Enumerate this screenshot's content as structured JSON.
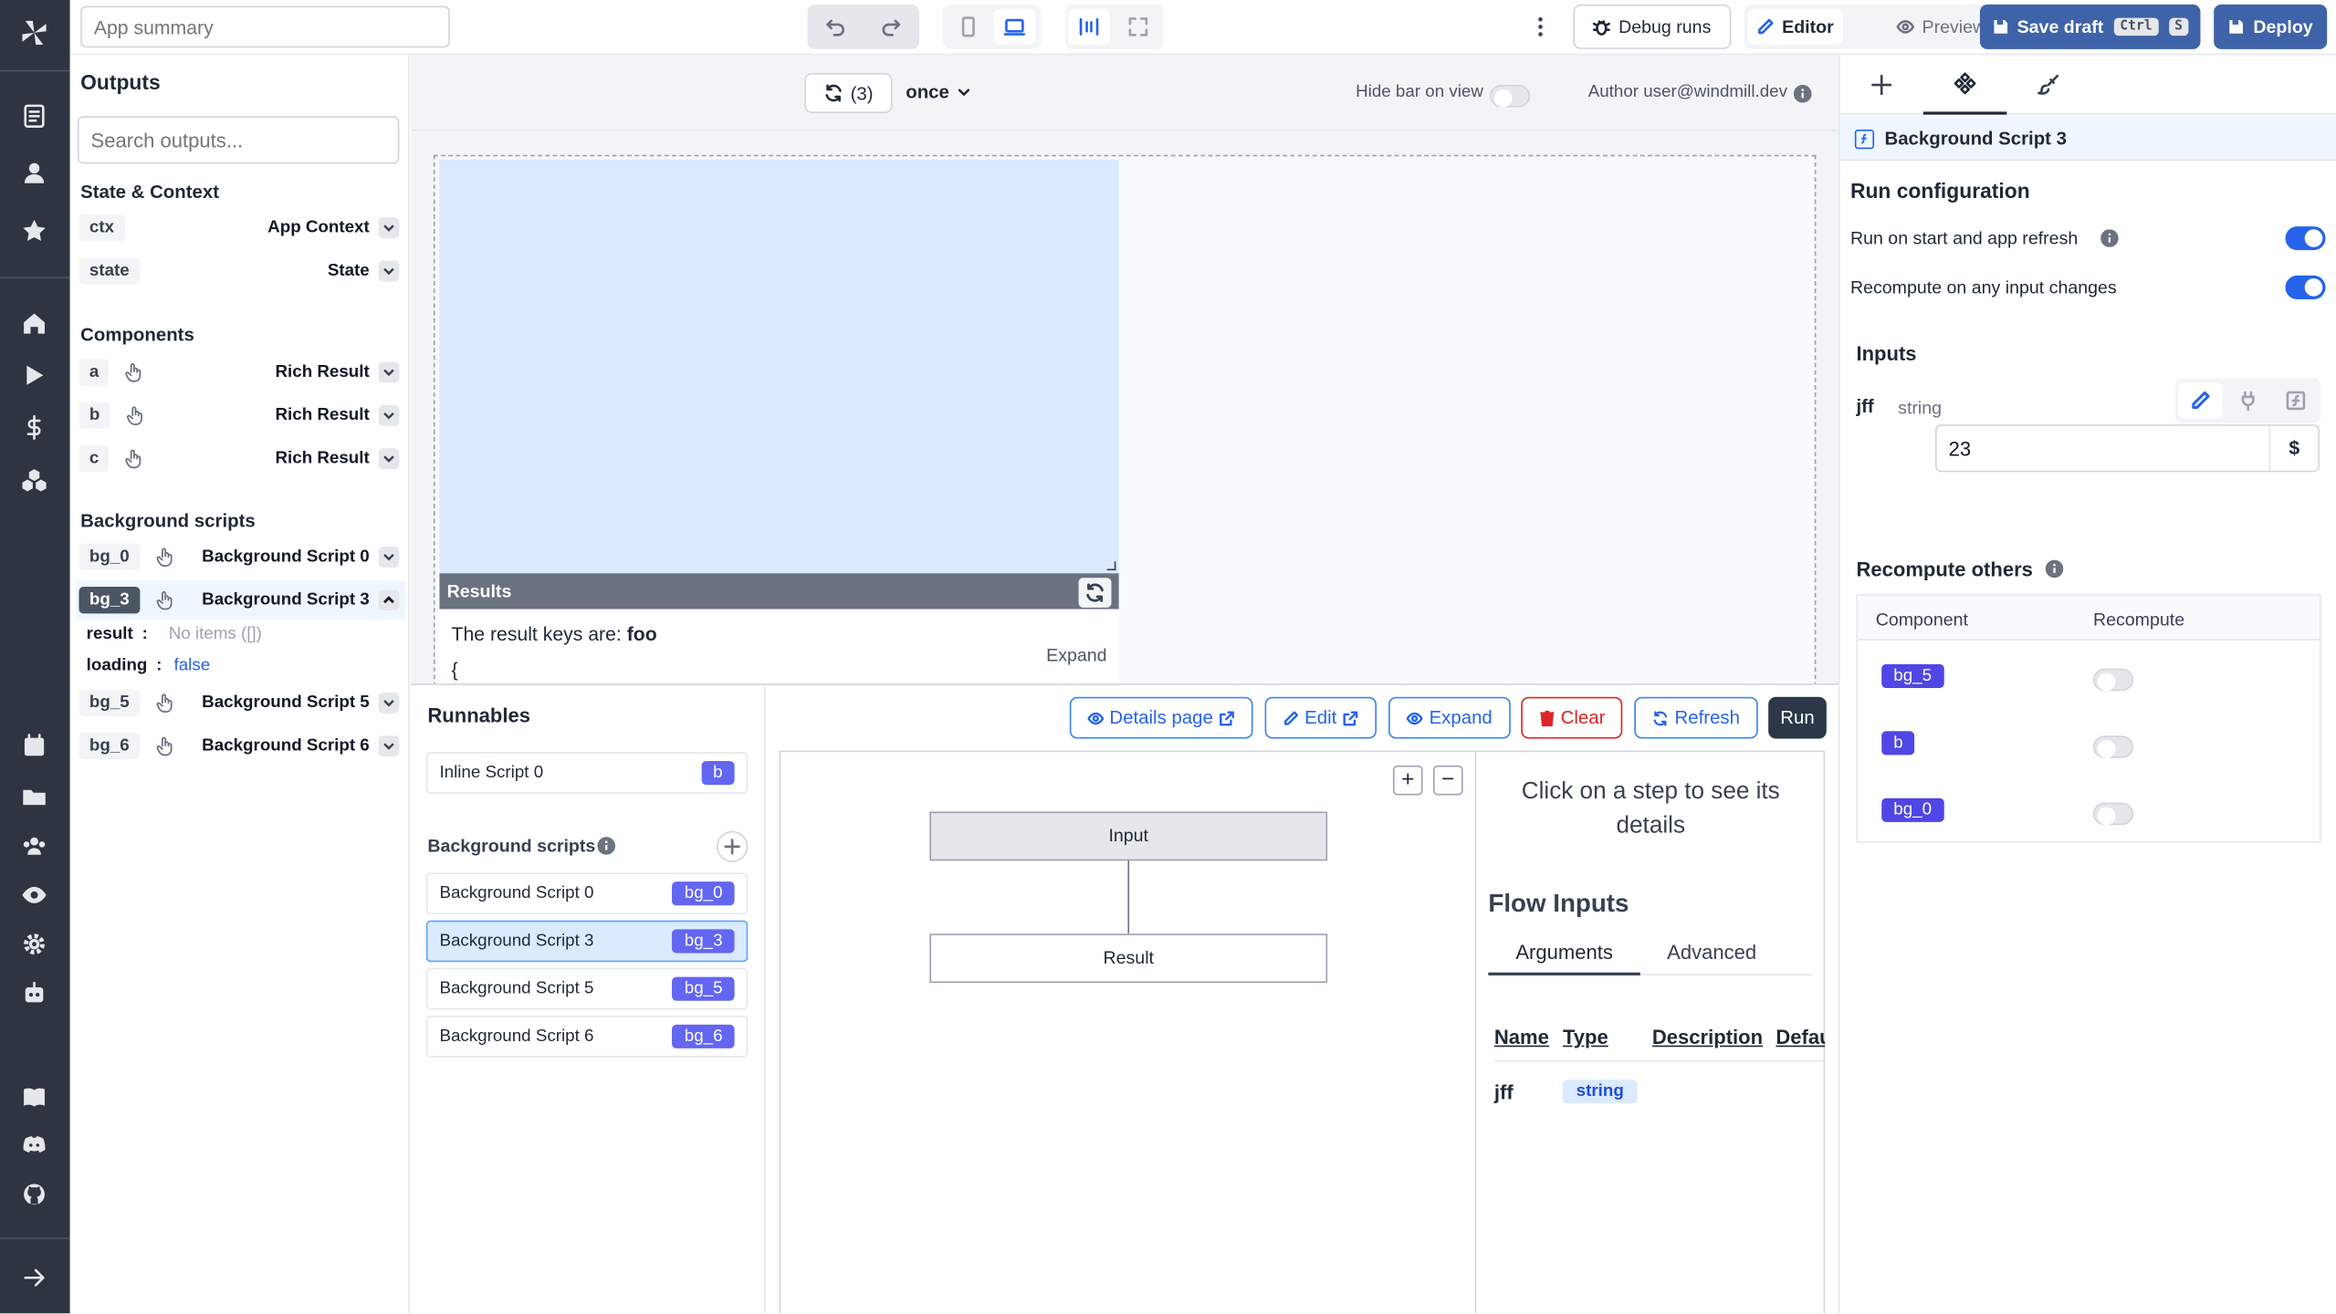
{
  "topbar": {
    "app_name_placeholder": "App summary",
    "debug_runs": "Debug runs",
    "editor": "Editor",
    "preview": "Preview",
    "save_draft": "Save draft",
    "kbd_ctrl": "Ctrl",
    "kbd_s": "S",
    "deploy": "Deploy"
  },
  "outputs": {
    "title": "Outputs",
    "search_placeholder": "Search outputs...",
    "state_context_title": "State & Context",
    "state_context": [
      {
        "id": "ctx",
        "name": "App Context"
      },
      {
        "id": "state",
        "name": "State"
      }
    ],
    "components_title": "Components",
    "components": [
      {
        "id": "a",
        "name": "Rich Result"
      },
      {
        "id": "b",
        "name": "Rich Result"
      },
      {
        "id": "c",
        "name": "Rich Result"
      }
    ],
    "background_title": "Background scripts",
    "background": [
      {
        "id": "bg_0",
        "name": "Background Script 0"
      },
      {
        "id": "bg_3",
        "name": "Background Script 3"
      },
      {
        "id": "bg_5",
        "name": "Background Script 5"
      },
      {
        "id": "bg_6",
        "name": "Background Script 6"
      }
    ],
    "expanded": {
      "result_key": "result",
      "result_sep": ":",
      "result_value": "No items ([])",
      "loading_key": "loading",
      "loading_sep": ":",
      "loading_value": "false"
    }
  },
  "app_bar": {
    "refresh_count": "(3)",
    "refresh_mode": "once",
    "hide_bar_label": "Hide bar on view",
    "author": "Author user@windmill.dev"
  },
  "canvas": {
    "results_header": "Results",
    "result_text_prefix": "The result keys are:",
    "result_text_key": "foo",
    "brace": "{",
    "expand": "Expand"
  },
  "runnables": {
    "title": "Runnables",
    "inline": [
      {
        "name": "Inline Script 0",
        "badge": "b"
      }
    ],
    "background_title": "Background scripts",
    "background": [
      {
        "name": "Background Script 0",
        "badge": "bg_0"
      },
      {
        "name": "Background Script 3",
        "badge": "bg_3"
      },
      {
        "name": "Background Script 5",
        "badge": "bg_5"
      },
      {
        "name": "Background Script 6",
        "badge": "bg_6"
      }
    ]
  },
  "script_toolbar": {
    "details_page": "Details page",
    "edit": "Edit",
    "expand": "Expand",
    "clear": "Clear",
    "refresh": "Refresh",
    "run": "Run"
  },
  "flow": {
    "input_node": "Input",
    "result_node": "Result",
    "zoom_in": "+",
    "zoom_out": "−",
    "step_hint": "Click on a step to see its details",
    "flow_inputs_title": "Flow Inputs",
    "tabs": [
      "Arguments",
      "Advanced"
    ],
    "columns": [
      "Name",
      "Type",
      "Description",
      "Default"
    ],
    "rows": [
      {
        "name": "jff",
        "type": "string"
      }
    ]
  },
  "settings": {
    "tabs": [
      "add-icon",
      "component-icon",
      "brush-icon"
    ],
    "selected_name": "Background Script 3",
    "run_config_title": "Run configuration",
    "run_on_start": "Run on start and app refresh",
    "recompute_on_change": "Recompute on any input changes",
    "inputs_title": "Inputs",
    "input_name": "jff",
    "input_type": "string",
    "input_value": "23",
    "input_suffix": "$",
    "recompute_others_title": "Recompute others",
    "recompute_cols": [
      "Component",
      "Recompute"
    ],
    "recompute_rows": [
      "bg_5",
      "b",
      "bg_0"
    ]
  },
  "colors": {
    "accent": "#2563eb",
    "badge": "#6366f1",
    "rail": "#2e3440",
    "canvas_selection": "#dbeafe",
    "danger": "#dc2626"
  }
}
